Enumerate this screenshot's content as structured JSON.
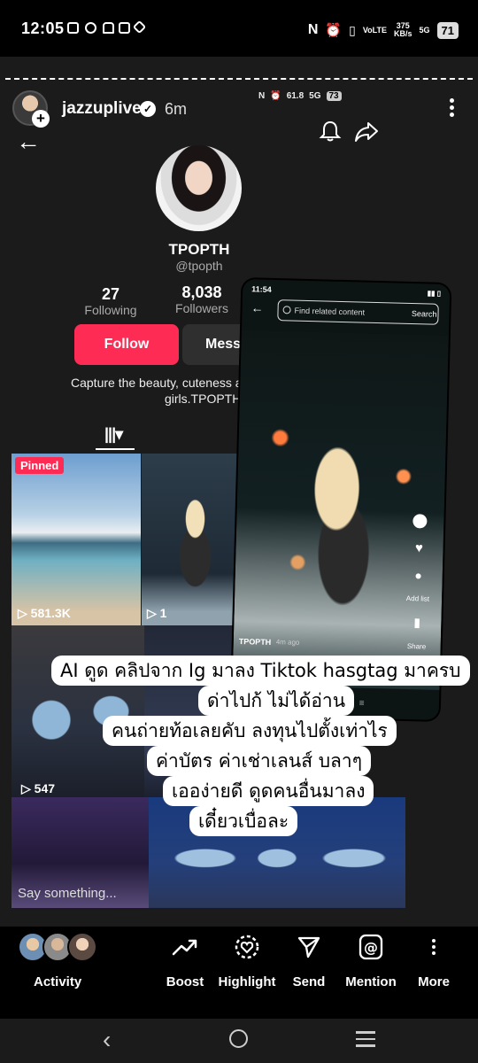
{
  "status_bar": {
    "time": "12:05",
    "left_icons": [
      "instagram-icon",
      "line-icon",
      "app-icon",
      "shopee-icon",
      "location-icon"
    ],
    "right": {
      "volte": "VoLTE",
      "speed": "375",
      "speed_unit": "KB/s",
      "network": "5G",
      "battery": "71"
    }
  },
  "story": {
    "username": "jazzuplive",
    "time_ago": "6m",
    "inner_status": {
      "speed": "61.8",
      "network": "5G",
      "battery": "73"
    }
  },
  "profile": {
    "name": "TPOPTH",
    "handle": "@tpopth",
    "following_count": "27",
    "following_label": "Following",
    "followers_count": "8,038",
    "followers_label": "Followers",
    "follow_button": "Follow",
    "message_button": "Messa",
    "bio_line1": "Capture the beauty, cuteness a",
    "bio_line2": "girls.TPOPTH"
  },
  "grid": {
    "pinned": "Pinned",
    "tile1_views": "581.3K",
    "tile2_views": "1",
    "tile3_views": "547"
  },
  "inner_phone": {
    "time": "11:54",
    "search_placeholder": "Find related content",
    "search_button": "Search",
    "creator": "TPOPTH",
    "time_ago": "4m ago",
    "add_list": "Add list",
    "share": "Share"
  },
  "caption": {
    "line1": "AI ดูด คลิปจาก Ig มาลง Tiktok hasgtag มาครบ",
    "line2": "ด่าไปก้ ไม่ได้อ่าน",
    "line3": "คนถ่ายท้อเลยคับ ลงทุนไปตั้งเท่าไร",
    "line4": "ค่าบัตร ค่าเช่าเลนส์ บลาๆ",
    "line5": "เออง่ายดี ดูดคนอื่นมาลง",
    "line6": "เดี๋ยวเบื่อละ"
  },
  "reply_placeholder": "Say something...",
  "actions": {
    "activity": "Activity",
    "boost": "Boost",
    "highlight": "Highlight",
    "send": "Send",
    "mention": "Mention",
    "more": "More"
  },
  "colors": {
    "accent": "#fe2c55",
    "background": "#1b1b1b"
  }
}
